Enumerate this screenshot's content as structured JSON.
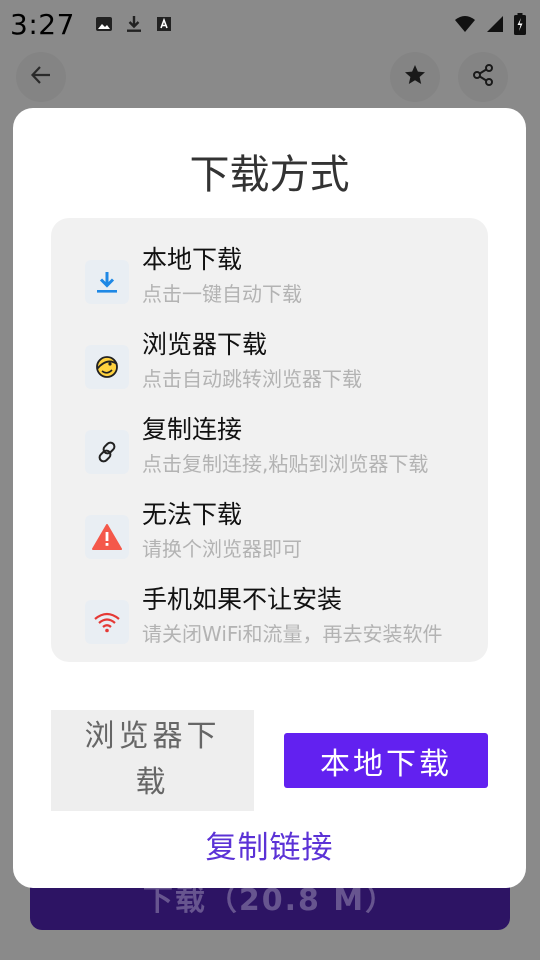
{
  "status_bar": {
    "time": "3:27",
    "icons_left": [
      "image-icon",
      "download-icon",
      "font-icon"
    ],
    "icons_right": [
      "wifi-icon",
      "signal-icon",
      "battery-charging-icon"
    ]
  },
  "app_bar": {
    "back_icon": "arrow-left-icon",
    "favorite_icon": "star-icon",
    "share_icon": "share-icon"
  },
  "background": {
    "download_button_label": "下载（20.8 M）",
    "download_button_color": "#2d1464"
  },
  "dialog": {
    "title": "下载方式",
    "options": [
      {
        "icon": "download-arrow-icon",
        "title": "本地下载",
        "desc": "点击一键自动下载"
      },
      {
        "icon": "browser-icon",
        "title": "浏览器下载",
        "desc": "点击自动跳转浏览器下载"
      },
      {
        "icon": "link-icon",
        "title": "复制连接",
        "desc": "点击复制连接,粘贴到浏览器下载"
      },
      {
        "icon": "warning-icon",
        "title": "无法下载",
        "desc": "请换个浏览器即可"
      },
      {
        "icon": "wifi-icon",
        "title": "手机如果不让安装",
        "desc": "请关闭WiFi和流量，再去安装软件"
      }
    ],
    "buttons": {
      "browser": "浏览器下载",
      "local": "本地下载",
      "copy": "复制链接"
    },
    "accent_color": "#6221f0",
    "link_color": "#5b32d6"
  }
}
